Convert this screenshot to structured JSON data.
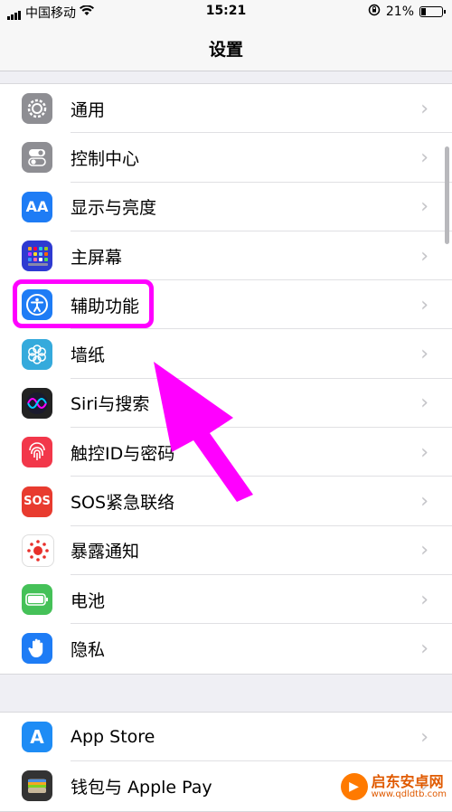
{
  "status": {
    "carrier": "中国移动",
    "time": "15:21",
    "battery": "21%"
  },
  "nav": {
    "title": "设置"
  },
  "group1": [
    {
      "label": "通用",
      "icon": "gear-icon",
      "color": "#8e8e93"
    },
    {
      "label": "控制中心",
      "icon": "toggles-icon",
      "color": "#8e8e93"
    },
    {
      "label": "显示与亮度",
      "icon": "aa-icon",
      "color": "#1e7cf5",
      "glyph": "AA"
    },
    {
      "label": "主屏幕",
      "icon": "grid-icon",
      "color": "#2e3ad1"
    },
    {
      "label": "辅助功能",
      "icon": "accessibility-icon",
      "color": "#1e7cf5"
    },
    {
      "label": "墙纸",
      "icon": "flower-icon",
      "color": "#35aadc"
    },
    {
      "label": "Siri与搜索",
      "icon": "siri-icon",
      "color": "#222"
    },
    {
      "label": "触控ID与密码",
      "icon": "fingerprint-icon",
      "color": "#f2374a"
    },
    {
      "label": "SOS紧急联络",
      "icon": "sos-icon",
      "color": "#e83b2f",
      "glyph": "SOS"
    },
    {
      "label": "暴露通知",
      "icon": "exposure-icon",
      "color": "#fff"
    },
    {
      "label": "电池",
      "icon": "battery-icon",
      "color": "#45c158"
    },
    {
      "label": "隐私",
      "icon": "hand-icon",
      "color": "#1e7cf5"
    }
  ],
  "group2": [
    {
      "label": "App Store",
      "icon": "appstore-icon",
      "color": "#1e8cf5",
      "glyph": "A"
    },
    {
      "label": "钱包与 Apple Pay",
      "icon": "wallet-icon",
      "color": "#333"
    }
  ],
  "watermark": {
    "name": "启东安卓网",
    "url": "www.qdldtb.com"
  }
}
